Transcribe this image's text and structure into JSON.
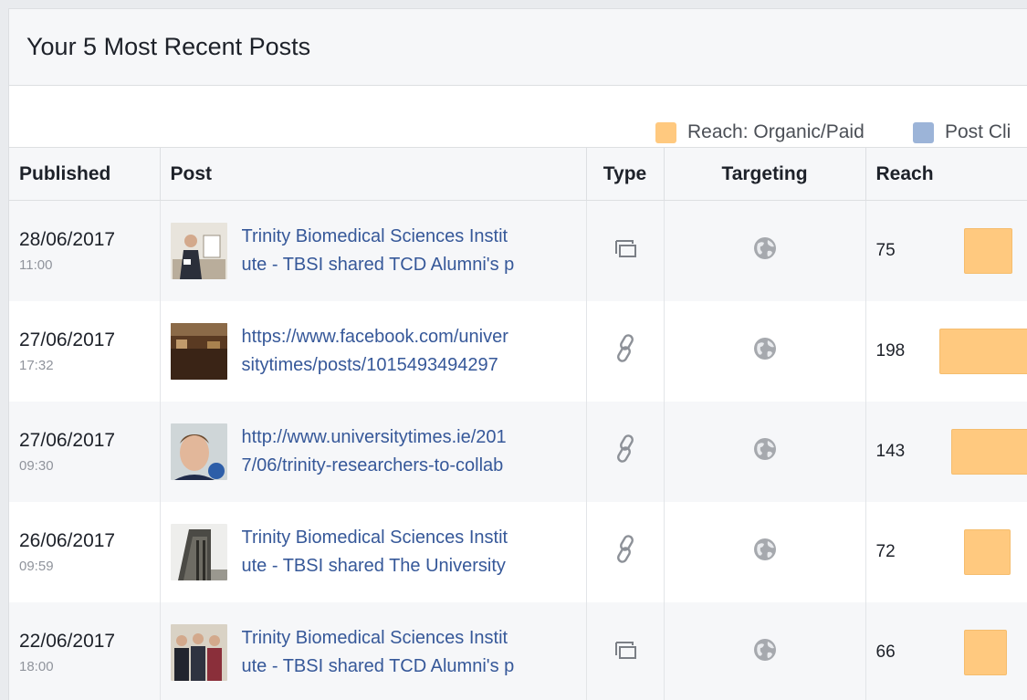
{
  "title": "Your 5 Most Recent Posts",
  "legend": [
    {
      "label": "Reach: Organic/Paid",
      "color": "#ffc97f"
    },
    {
      "label": "Post Cli",
      "color": "#9cb4d8"
    }
  ],
  "columns": {
    "published": "Published",
    "post": "Post",
    "type": "Type",
    "targeting": "Targeting",
    "reach": "Reach"
  },
  "rows": [
    {
      "date": "28/06/2017",
      "time": "11:00",
      "line1": "Trinity Biomedical Sciences Instit",
      "line2": "ute - TBSI shared TCD Alumni's p",
      "type_icon": "album-icon",
      "targeting_icon": "globe-icon",
      "reach": "75",
      "reach_value": 75,
      "thumb": "ceremony-photo"
    },
    {
      "date": "27/06/2017",
      "time": "17:32",
      "line1": "https://www.facebook.com/univer",
      "line2": "sitytimes/posts/1015493494297",
      "type_icon": "link-icon",
      "targeting_icon": "globe-icon",
      "reach": "198",
      "reach_value": 198,
      "thumb": "interior-photo"
    },
    {
      "date": "27/06/2017",
      "time": "09:30",
      "line1": "http://www.universitytimes.ie/201",
      "line2": "7/06/trinity-researchers-to-collab",
      "type_icon": "link-icon",
      "targeting_icon": "globe-icon",
      "reach": "143",
      "reach_value": 143,
      "thumb": "portrait-photo"
    },
    {
      "date": "26/06/2017",
      "time": "09:59",
      "line1": "Trinity Biomedical Sciences Instit",
      "line2": "ute - TBSI shared The University",
      "type_icon": "link-icon",
      "targeting_icon": "globe-icon",
      "reach": "72",
      "reach_value": 72,
      "thumb": "building-photo"
    },
    {
      "date": "22/06/2017",
      "time": "18:00",
      "line1": "Trinity Biomedical Sciences Instit",
      "line2": "ute - TBSI shared TCD Alumni's p",
      "type_icon": "album-icon",
      "targeting_icon": "globe-icon",
      "reach": "66",
      "reach_value": 66,
      "thumb": "group-photo"
    }
  ]
}
